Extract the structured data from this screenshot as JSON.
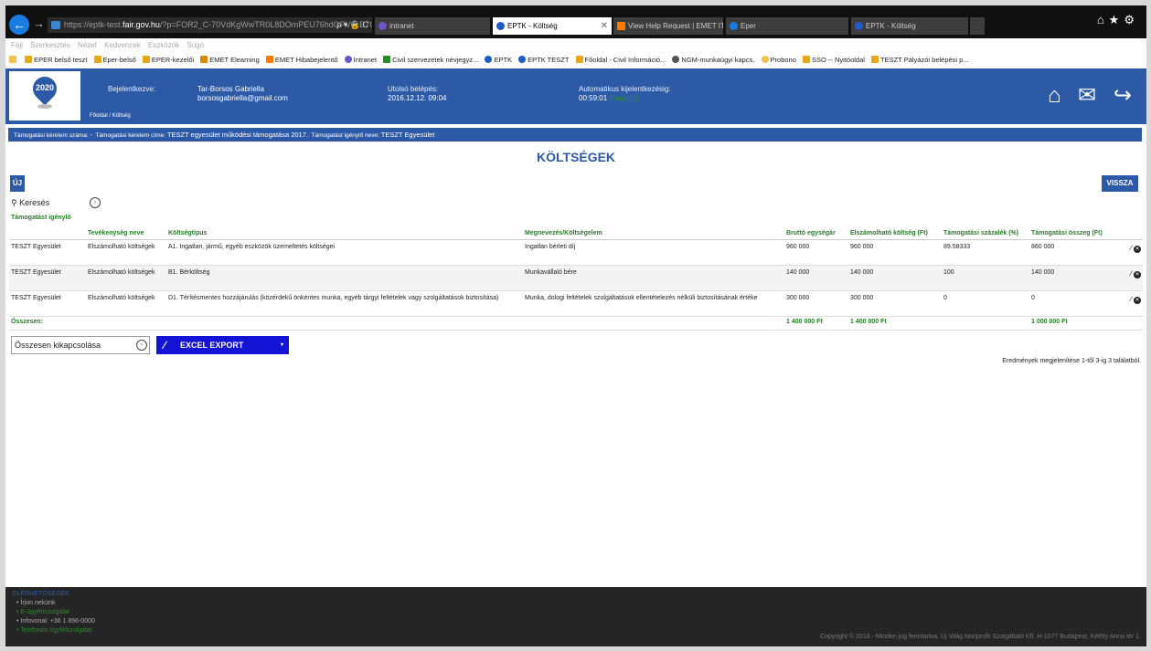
{
  "browser": {
    "url_prefix": "https://",
    "url_path": "eptk-test.",
    "url_host": "fair.gov.hu",
    "url_rest": "/?p=FOR2_C-70VdKgWwTR0L8DOmPEU76hdGPV0cB7G...",
    "url_controls": "ρ ▾ 🔒 C",
    "tabs": [
      {
        "label": "intranet",
        "color": "#6b57c7"
      },
      {
        "label": "EPTK - Költség",
        "color": "#1e5cc8"
      },
      {
        "label": "View Help Request | EMET IT H...",
        "color": "#ff7a00"
      },
      {
        "label": "Eper",
        "color": "#1a7be0"
      },
      {
        "label": "EPTK - Költség",
        "color": "#1e5cc8"
      }
    ],
    "window_icons": "⌂★⚙",
    "menu": [
      "Fájl",
      "Szerkesztés",
      "Nézet",
      "Kedvencek",
      "Eszközök",
      "Súgó"
    ],
    "favorites": [
      {
        "label": "EPER belső teszt",
        "color": "#e6a817"
      },
      {
        "label": "Eper-belső",
        "color": "#e6a817"
      },
      {
        "label": "EPER-kezelői",
        "color": "#e6a817"
      },
      {
        "label": "EMET Elearning",
        "color": "#d88b00"
      },
      {
        "label": "EMET Hibabejelentő",
        "color": "#ff7a00"
      },
      {
        "label": "Intranet",
        "color": "#6b57c7"
      },
      {
        "label": "Civil szervezetek névjegyz...",
        "color": "#2a8a2a"
      },
      {
        "label": "EPTK",
        "color": "#1e5cc8"
      },
      {
        "label": "EPTK TESZT",
        "color": "#1e5cc8"
      },
      {
        "label": "Főoldal - Civil Információ...",
        "color": "#e6a817"
      },
      {
        "label": "NGM-munkaügyi kapcs.",
        "color": "#555555"
      },
      {
        "label": "Probono",
        "color": "#f2c14e"
      },
      {
        "label": "SSO -- Nyitóoldal",
        "color": "#e6a817"
      },
      {
        "label": "TESZT Pályázói belépési p...",
        "color": "#e6a817"
      }
    ]
  },
  "header": {
    "logo_text": "2020",
    "logged_in_label": "Bejelentkezve:",
    "user_name": "Tar-Borsos Gabriella",
    "user_email": "borsosgabriella@gmail.com",
    "last_login_label": "Utolsó belépés:",
    "last_login_value": "2016.12.12. 09:04",
    "auto_logout_label": "Automatikus kijelentkezésig:",
    "auto_logout_time": "00:59:01",
    "auto_logout_renew": "[megújít]",
    "breadcrumb_home": "Főoldal",
    "breadcrumb_sep": "/",
    "breadcrumb_current": "Költség",
    "home_icon": "⌂",
    "mail_icon": "✉",
    "logout_icon": "↪"
  },
  "info_strip": {
    "request_number_label": "Támogatási kérelem száma:",
    "request_number_value": "-",
    "request_title_label": "Támogatási kérelem címe:",
    "request_title_value": "TESZT egyesület működési támogatása 2017.",
    "applicant_label": "Támogatást igénylő neve:",
    "applicant_value": "TESZT Egyesület"
  },
  "page": {
    "title": "KÖLTSÉGEK",
    "new_button": "ÚJ",
    "back_button": "VISSZA",
    "search_label": "Keresés",
    "search_toggle": "›",
    "total_toggle_label": "Összesen kikapcsolása",
    "export_label": "EXCEL EXPORT",
    "export_arrow": "▾",
    "export_icon": "∕",
    "results_text": "Eredmények megjelenítése 1-től 3-ig 3 találatból."
  },
  "table": {
    "headers": {
      "applicant": "Támogatást igénylő",
      "activity": "Tevékenység neve",
      "cost_type": "Költségtípus",
      "item": "Megnevezés/Költségelem",
      "gross": "Bruttó egységár",
      "eligible": "Elszámolható költség (Ft)",
      "percent": "Támogatási százalék (%)",
      "amount": "Támogatási összeg (Ft)"
    },
    "rows": [
      {
        "applicant": "TESZT Egyesület",
        "activity": "Elszámolható költségek",
        "cost_type": "A1. Ingatlan, jármű, egyéb eszközök üzemeltetés költségei",
        "item": "Ingatlan bérleti díj",
        "gross": "960 000",
        "eligible": "960 000",
        "percent": "89.58333",
        "amount": "860 000",
        "edit_icon": "∕",
        "delete_icon": "✕"
      },
      {
        "applicant": "TESZT Egyesület",
        "activity": "Elszámolható költségek",
        "cost_type": "B1. Bérköltség",
        "item": "Munkavállaló bére",
        "gross": "140 000",
        "eligible": "140 000",
        "percent": "100",
        "amount": "140 000",
        "edit_icon": "∕",
        "delete_icon": "✕"
      },
      {
        "applicant": "TESZT Egyesület",
        "activity": "Elszámolható költségek",
        "cost_type": "D1. Térítésmentes hozzájárulás (közérdekű önkéntes munka, egyéb tárgyi feltételek vagy szolgáltatások biztosítása)",
        "item": "Munka, dologi feltételek szolgáltatások ellentételezés nélküli biztosításának értéke",
        "gross": "300 000",
        "eligible": "300 000",
        "percent": "0",
        "amount": "0",
        "edit_icon": "∕",
        "delete_icon": "✕"
      }
    ],
    "totals": {
      "label": "Összesen:",
      "gross": "1 400 000 Ft",
      "eligible": "1 400 000 Ft",
      "amount": "1 000 000 Ft"
    }
  },
  "footer": {
    "title": "ELÉRHETŐSÉGEK",
    "links": [
      "Írjon nekünk",
      "E-ügyfélszolgálat",
      "Infovonal: +36 1 896-0000",
      "Telefonos ügyfélszolgálat"
    ],
    "bullet": "•",
    "copyright": "Copyright © 2016 - Minden jog fenntartva. Új Világ Nonprofit Szolgáltató Kft. H-1077 Budapest, Kéthly Anna tér 1."
  }
}
